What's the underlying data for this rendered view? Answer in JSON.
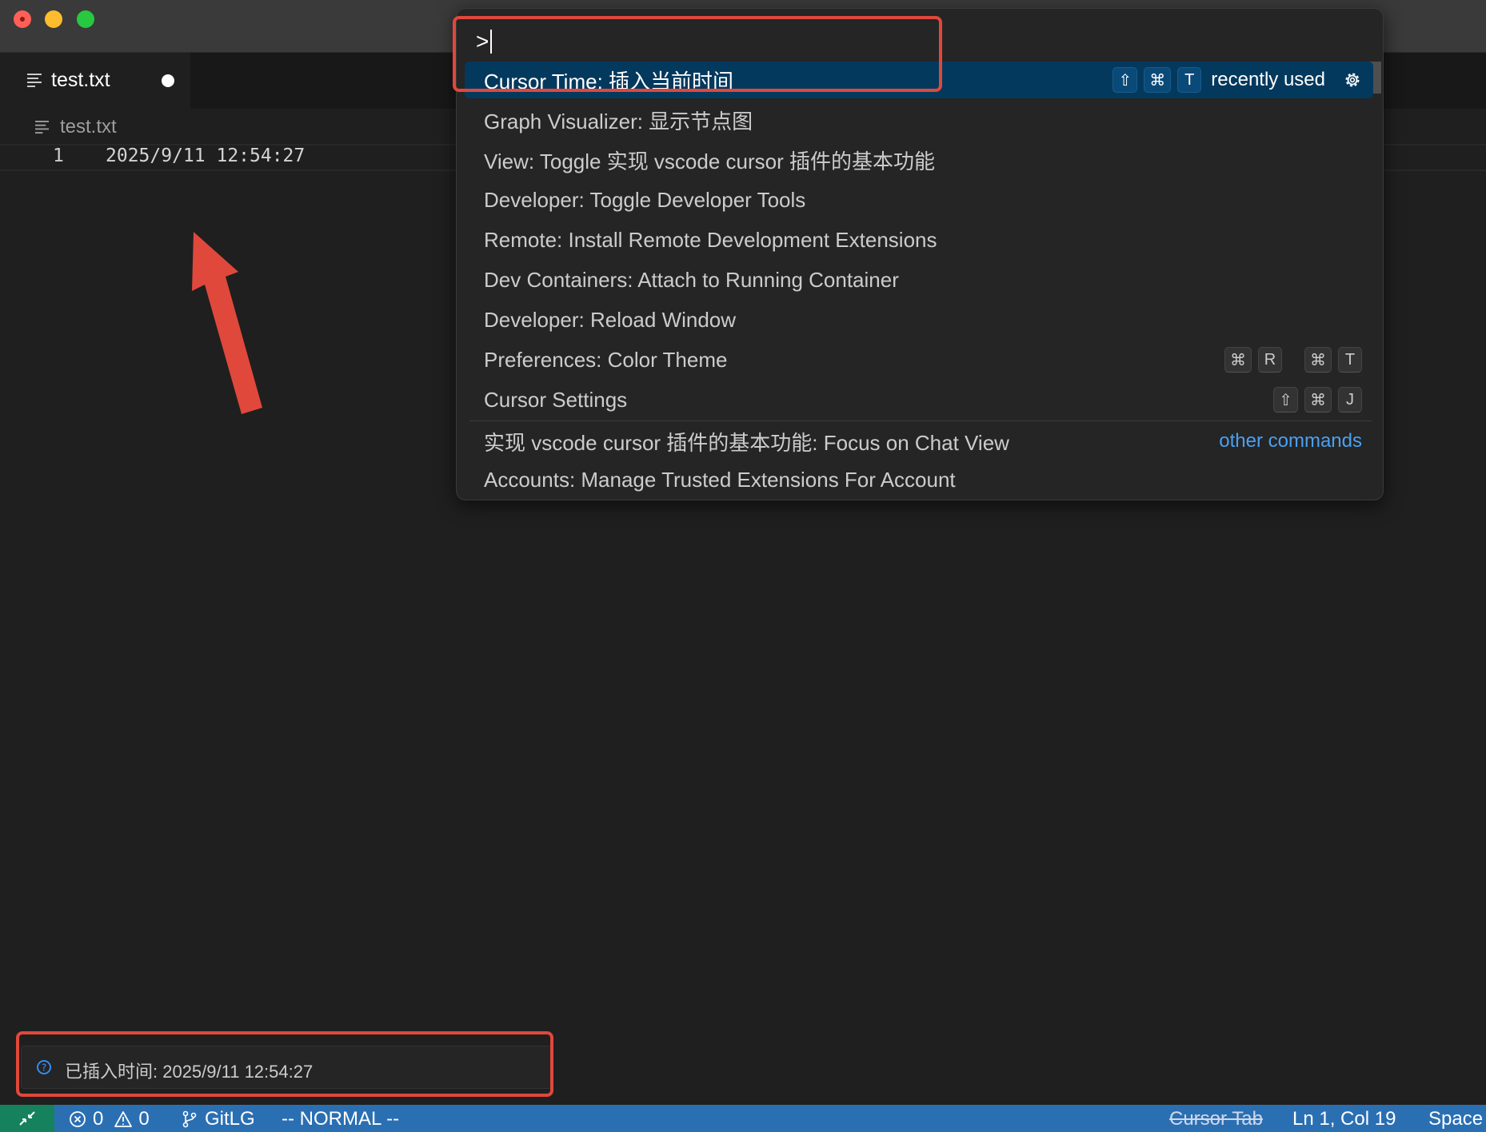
{
  "window": {
    "tab": {
      "label": "test.txt"
    },
    "breadcrumb": {
      "file": "test.txt"
    }
  },
  "editor": {
    "line_number": "1",
    "line_text": "2025/9/11 12:54:27"
  },
  "palette": {
    "input_value": ">",
    "items": [
      {
        "label": "Cursor Time: 插入当前时间",
        "keys": [
          "⇧",
          "⌘",
          "T"
        ],
        "recent": "recently used"
      },
      {
        "label": "Graph Visualizer: 显示节点图"
      },
      {
        "label": "View: Toggle 实现 vscode cursor 插件的基本功能"
      },
      {
        "label": "Developer: Toggle Developer Tools"
      },
      {
        "label": "Remote: Install Remote Development Extensions"
      },
      {
        "label": "Dev Containers: Attach to Running Container"
      },
      {
        "label": "Developer: Reload Window"
      },
      {
        "label": "Preferences: Color Theme",
        "keys": [
          "⌘",
          "R",
          "⌘",
          "T"
        ]
      },
      {
        "label": "Cursor Settings",
        "keys": [
          "⇧",
          "⌘",
          "J"
        ]
      },
      {
        "label": "实现 vscode cursor 插件的基本功能: Focus on Chat View",
        "other": "other commands"
      },
      {
        "label": "Accounts: Manage Trusted Extensions For Account"
      }
    ]
  },
  "notification": {
    "message": "已插入时间: 2025/9/11 12:54:27"
  },
  "statusbar": {
    "errors": "0",
    "warnings": "0",
    "git": "GitLG",
    "mode": "-- NORMAL --",
    "cursor_tab": "Cursor Tab",
    "position": "Ln 1, Col 19",
    "spaces": "Space"
  },
  "colors": {
    "accent": "#2b6fb3",
    "selection": "#04395e",
    "annotation": "#e0483c",
    "link": "#4aa1f0"
  }
}
